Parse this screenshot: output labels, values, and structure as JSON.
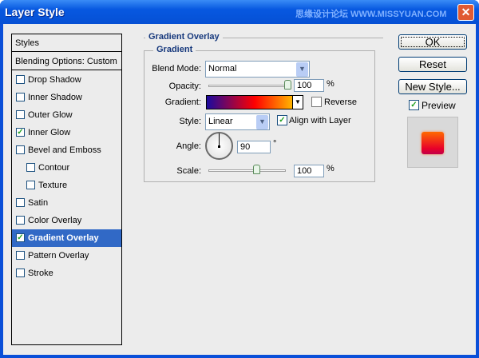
{
  "window": {
    "title": "Layer Style",
    "watermark": "思缘设计论坛 WWW.MISSYUAN.COM"
  },
  "sidebar": {
    "header": "Styles",
    "blending": "Blending Options: Custom",
    "items": [
      {
        "label": "Drop Shadow",
        "checked": false,
        "indent": false
      },
      {
        "label": "Inner Shadow",
        "checked": false,
        "indent": false
      },
      {
        "label": "Outer Glow",
        "checked": false,
        "indent": false
      },
      {
        "label": "Inner Glow",
        "checked": true,
        "indent": false
      },
      {
        "label": "Bevel and Emboss",
        "checked": false,
        "indent": false
      },
      {
        "label": "Contour",
        "checked": false,
        "indent": true
      },
      {
        "label": "Texture",
        "checked": false,
        "indent": true
      },
      {
        "label": "Satin",
        "checked": false,
        "indent": false
      },
      {
        "label": "Color Overlay",
        "checked": false,
        "indent": false
      },
      {
        "label": "Gradient Overlay",
        "checked": true,
        "indent": false,
        "selected": true
      },
      {
        "label": "Pattern Overlay",
        "checked": false,
        "indent": false
      },
      {
        "label": "Stroke",
        "checked": false,
        "indent": false
      }
    ]
  },
  "panel": {
    "section": "Gradient Overlay",
    "group": "Gradient",
    "blend_mode_label": "Blend Mode:",
    "blend_mode": "Normal",
    "opacity_label": "Opacity:",
    "opacity": "100",
    "opacity_unit": "%",
    "gradient_label": "Gradient:",
    "gradient_colors": [
      "#1a0a9e",
      "#ff0000",
      "#ffe600"
    ],
    "reverse_label": "Reverse",
    "reverse_checked": false,
    "style_label": "Style:",
    "style": "Linear",
    "align_label": "Align with Layer",
    "align_checked": true,
    "angle_label": "Angle:",
    "angle": "90",
    "angle_unit": "°",
    "scale_label": "Scale:",
    "scale": "100",
    "scale_unit": "%"
  },
  "buttons": {
    "ok": "OK",
    "reset": "Reset",
    "new_style": "New Style...",
    "preview": "Preview",
    "preview_checked": true
  }
}
